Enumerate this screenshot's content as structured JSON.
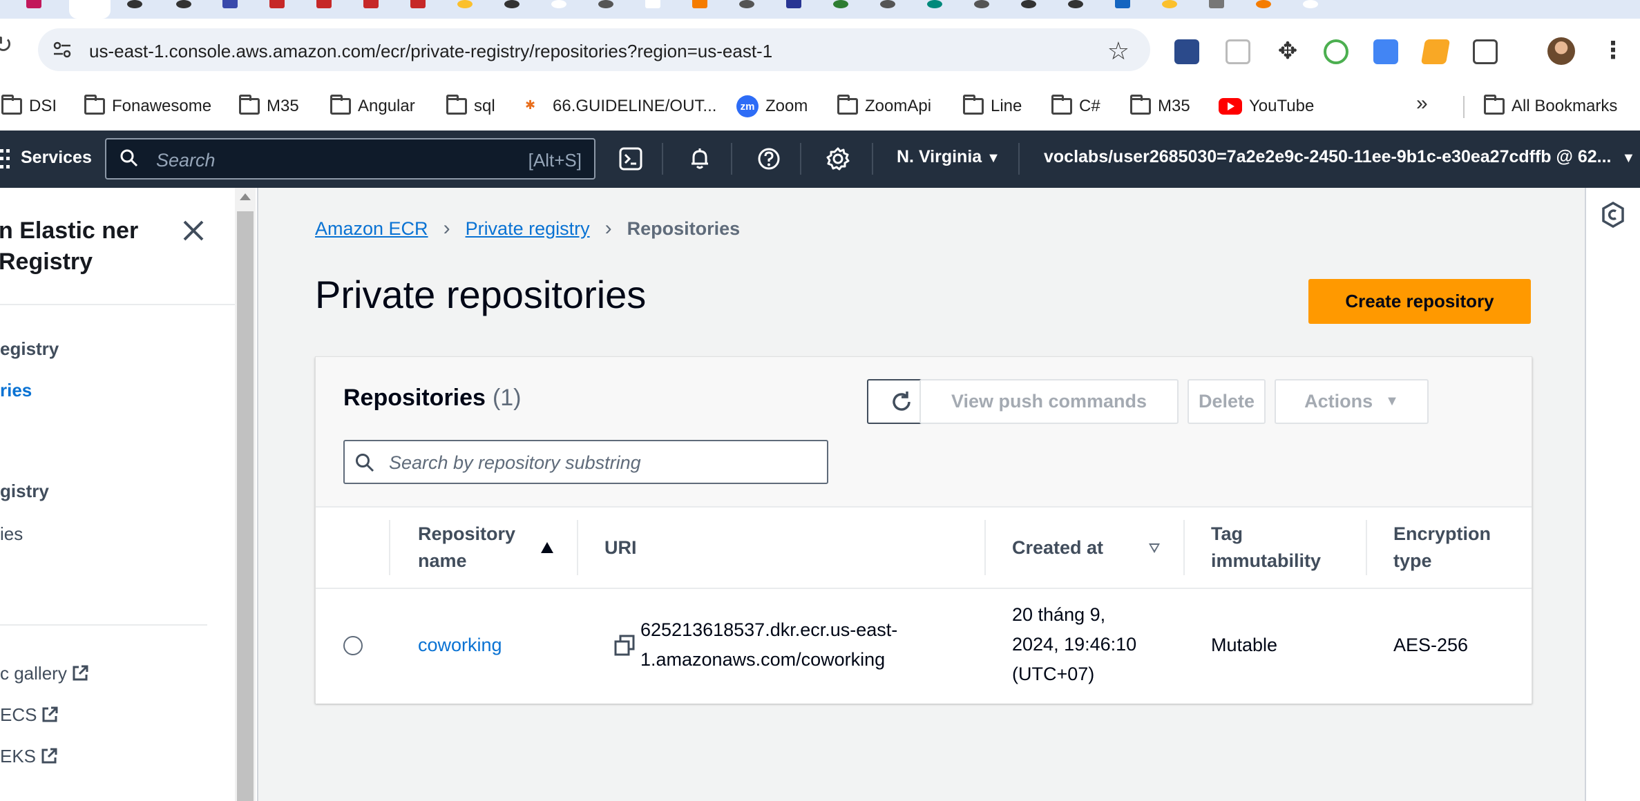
{
  "browser": {
    "url": "us-east-1.console.aws.amazon.com/ecr/private-registry/repositories?region=us-east-1",
    "bookmarks": [
      {
        "label": "DSI",
        "icon": "folder-icon"
      },
      {
        "label": "Fonawesome",
        "icon": "folder-icon"
      },
      {
        "label": "M35",
        "icon": "folder-icon"
      },
      {
        "label": "Angular",
        "icon": "folder-icon"
      },
      {
        "label": "sql",
        "icon": "folder-icon"
      },
      {
        "label": "66.GUIDELINE/OUT...",
        "icon": "fpt-icon"
      },
      {
        "label": "Zoom",
        "icon": "zoom-icon"
      },
      {
        "label": "ZoomApi",
        "icon": "folder-icon"
      },
      {
        "label": "Line",
        "icon": "folder-icon"
      },
      {
        "label": "C#",
        "icon": "folder-icon"
      },
      {
        "label": "M35",
        "icon": "folder-icon"
      },
      {
        "label": "YouTube",
        "icon": "youtube-icon"
      }
    ],
    "all_bookmarks": "All Bookmarks",
    "zoom_badge": "zm"
  },
  "awsnav": {
    "services": "Services",
    "search_placeholder": "Search",
    "search_shortcut": "[Alt+S]",
    "region": "N. Virginia",
    "account": "voclabs/user2685030=7a2e2e9c-2450-11ee-9b1c-e30ea27cdffb @ 62..."
  },
  "sidebar": {
    "title": "n Elastic ner Registry",
    "items": [
      {
        "label": "egistry",
        "kind": "head"
      },
      {
        "label": "ries",
        "kind": "link"
      },
      {
        "label": "gistry",
        "kind": "head"
      },
      {
        "label": "ies",
        "kind": "plain"
      },
      {
        "label": "c gallery",
        "kind": "external"
      },
      {
        "label": "ECS",
        "kind": "external"
      },
      {
        "label": "EKS",
        "kind": "external"
      }
    ]
  },
  "breadcrumbs": [
    {
      "label": "Amazon ECR",
      "link": true
    },
    {
      "label": "Private registry",
      "link": true
    },
    {
      "label": "Repositories",
      "link": false
    }
  ],
  "page": {
    "title": "Private repositories",
    "create_button": "Create repository"
  },
  "repositories": {
    "title": "Repositories",
    "count": "(1)",
    "view_push": "View push commands",
    "delete": "Delete",
    "actions": "Actions",
    "filter_placeholder": "Search by repository substring",
    "columns": {
      "name": "Repository name",
      "uri": "URI",
      "created": "Created at",
      "tag": "Tag immutability",
      "encryption": "Encryption type"
    },
    "rows": [
      {
        "name": "coworking",
        "uri_line1": "625213618537.dkr.ecr.us-east-",
        "uri_line2": "1.amazonaws.com/coworking",
        "created_line1": "20 tháng 9,",
        "created_line2": "2024, 19:46:10",
        "created_line3": "(UTC+07)",
        "tag": "Mutable",
        "encryption": "AES-256"
      }
    ]
  },
  "colors": {
    "aws_nav": "#232f3e",
    "primary_orange": "#ff9900",
    "link_blue": "#0972d3"
  }
}
